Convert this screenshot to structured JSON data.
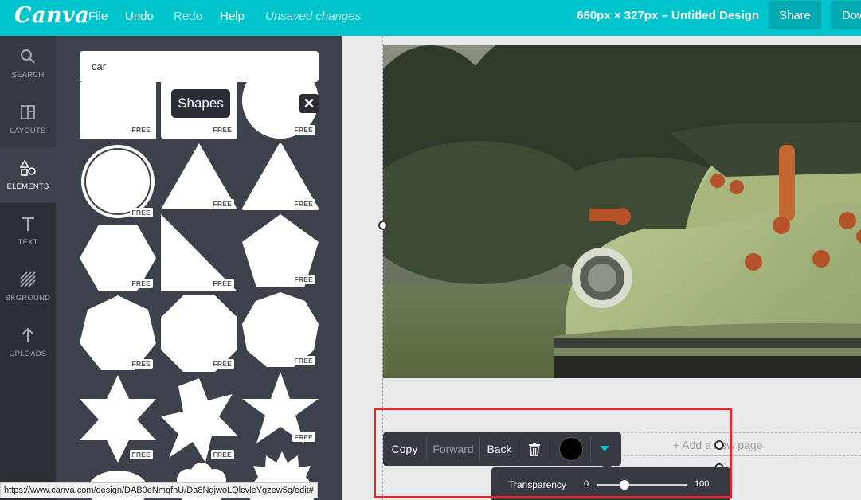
{
  "app": {
    "logo": "Canva",
    "menu": {
      "file": "File",
      "undo": "Undo",
      "redo": "Redo",
      "help": "Help",
      "status": "Unsaved changes"
    },
    "design_title": "660px × 327px – Untitled Design",
    "share_label": "Share",
    "download_label": "Download"
  },
  "rail": {
    "items": [
      {
        "label": "SEARCH",
        "icon": "search-icon"
      },
      {
        "label": "LAYOUTS",
        "icon": "layouts-icon"
      },
      {
        "label": "ELEMENTS",
        "icon": "elements-icon"
      },
      {
        "label": "TEXT",
        "icon": "text-icon"
      },
      {
        "label": "BKGROUND",
        "icon": "background-icon"
      },
      {
        "label": "UPLOADS",
        "icon": "uploads-icon"
      }
    ],
    "active_index": 2
  },
  "panel": {
    "search_value": "car",
    "tooltip": "Shapes",
    "close_symbol": "✕",
    "free_label": "FREE"
  },
  "canvas": {
    "add_page": "+ Add a new page",
    "image_subject": "green vintage car in front of trees"
  },
  "toolbar": {
    "copy": "Copy",
    "forward": "Forward",
    "back": "Back",
    "delete_icon": "trash-icon",
    "color": "#000000"
  },
  "transparency": {
    "label": "Transparency",
    "min": "0",
    "max": "100",
    "value_percent": 30
  },
  "status_url": "https://www.canva.com/design/DAB0eNmqfhU/Da8NgjwoLQlcvleYgzew5g/edit#",
  "colors": {
    "brand": "#00c4cc",
    "highlight": "#e3252c"
  }
}
